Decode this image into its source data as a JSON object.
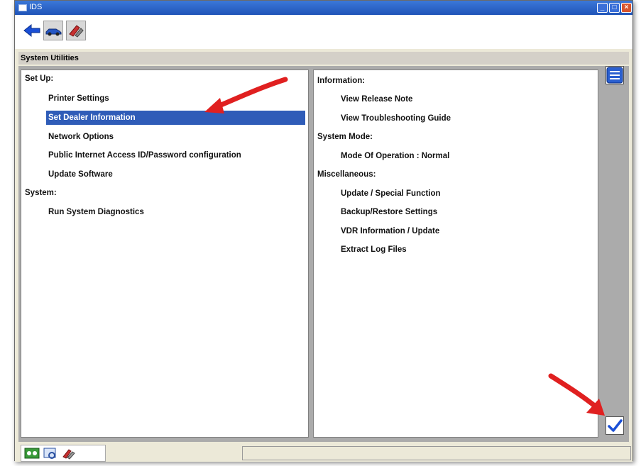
{
  "window": {
    "title": "IDS"
  },
  "section": {
    "title": "System Utilities"
  },
  "left_pane": {
    "groups": [
      {
        "label": "Set Up:",
        "items": [
          "Printer Settings",
          "Set Dealer Information",
          "Network Options",
          "Public Internet Access ID/Password configuration",
          "Update Software"
        ]
      },
      {
        "label": "System:",
        "items": [
          "Run System Diagnostics"
        ]
      }
    ],
    "selected_item": "Set Dealer Information"
  },
  "right_pane": {
    "groups": [
      {
        "label": "Information:",
        "items": [
          "View Release Note",
          "View Troubleshooting Guide"
        ]
      },
      {
        "label": "System Mode:",
        "items": [
          "Mode Of Operation : Normal"
        ]
      },
      {
        "label": "Miscellaneous:",
        "items": [
          "Update / Special Function",
          "Backup/Restore Settings",
          "VDR Information / Update",
          "Extract Log Files"
        ]
      }
    ]
  },
  "colors": {
    "selection": "#2f5cb8",
    "titlebar": "#2f66cc",
    "annotation_arrow": "#e02020"
  },
  "icons": [
    "back-arrow-icon",
    "vehicle-icon",
    "tools-icon",
    "list-icon",
    "checkmark-icon",
    "network-icon",
    "help-icon",
    "toolbox-icon"
  ]
}
